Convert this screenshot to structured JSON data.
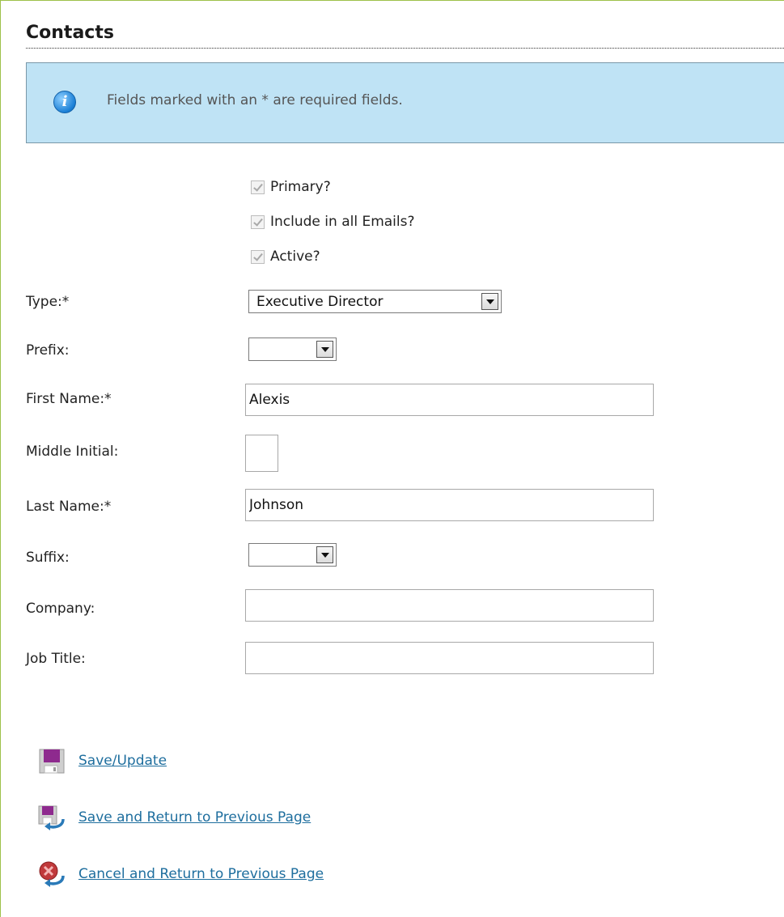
{
  "page": {
    "title": "Contacts"
  },
  "info": {
    "message": "Fields marked with an * are required fields."
  },
  "checkboxes": [
    {
      "label": "Primary?",
      "checked": true,
      "disabled": true
    },
    {
      "label": "Include in all Emails?",
      "checked": true,
      "disabled": true
    },
    {
      "label": "Active?",
      "checked": true,
      "disabled": true
    }
  ],
  "fields": {
    "type": {
      "label": "Type:*",
      "value": "Executive Director"
    },
    "prefix": {
      "label": "Prefix:",
      "value": ""
    },
    "first_name": {
      "label": "First Name:*",
      "value": "Alexis"
    },
    "middle_initial": {
      "label": "Middle Initial:",
      "value": ""
    },
    "last_name": {
      "label": "Last Name:*",
      "value": "Johnson"
    },
    "suffix": {
      "label": "Suffix:",
      "value": ""
    },
    "company": {
      "label": "Company:",
      "value": ""
    },
    "job_title": {
      "label": "Job Title:",
      "value": ""
    }
  },
  "actions": {
    "save": "Save/Update",
    "save_return": "Save and Return to Previous Page",
    "cancel_return": "Cancel and Return to Previous Page"
  },
  "colors": {
    "frame_border": "#9ec14a",
    "info_background": "#bfe3f5",
    "link": "#1e6e9e",
    "save_icon": "#8e2a8e",
    "cancel_icon": "#c0393b"
  }
}
